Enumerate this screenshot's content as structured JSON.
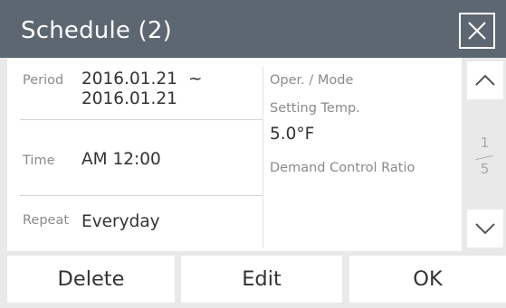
{
  "dialog": {
    "title": "Schedule (2)",
    "close_icon": "close-icon"
  },
  "details": {
    "period_label": "Period",
    "period_start": "2016.01.21",
    "period_separator": "~",
    "period_end": "2016.01.21",
    "time_label": "Time",
    "time_value": "AM 12:00",
    "repeat_label": "Repeat",
    "repeat_value": "Everyday",
    "oper_mode_label": "Oper. / Mode",
    "setting_temp_label": "Setting Temp.",
    "setting_temp_value": "5.0°F",
    "demand_label": "Demand Control Ratio"
  },
  "pager": {
    "current": "1",
    "total": "5",
    "up_icon": "chevron-up-icon",
    "down_icon": "chevron-down-icon"
  },
  "buttons": {
    "delete": "Delete",
    "edit": "Edit",
    "ok": "OK"
  },
  "colors": {
    "titlebar": "#5d6771",
    "panel": "#e9e9e9",
    "label": "#8a8a8a",
    "value": "#333333"
  }
}
